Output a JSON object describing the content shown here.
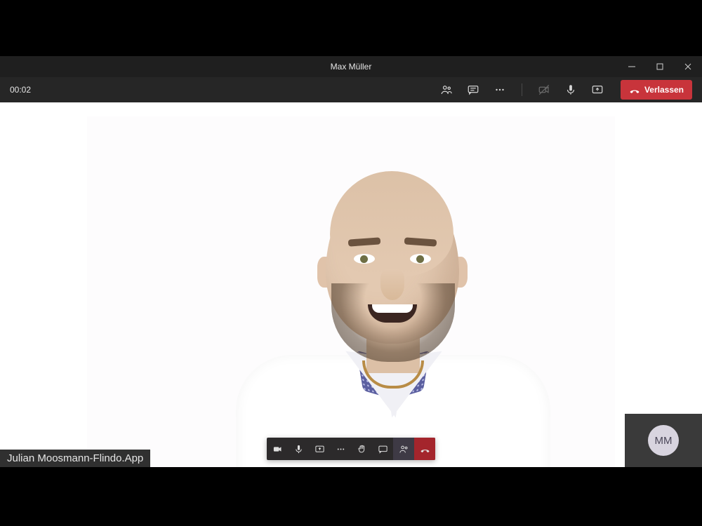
{
  "titlebar": {
    "title": "Max Müller"
  },
  "toolbar": {
    "timer": "00:02",
    "leave_label": "Verlassen"
  },
  "caption": "Julian Moosmann-Flindo.App",
  "avatar_initials": "MM"
}
